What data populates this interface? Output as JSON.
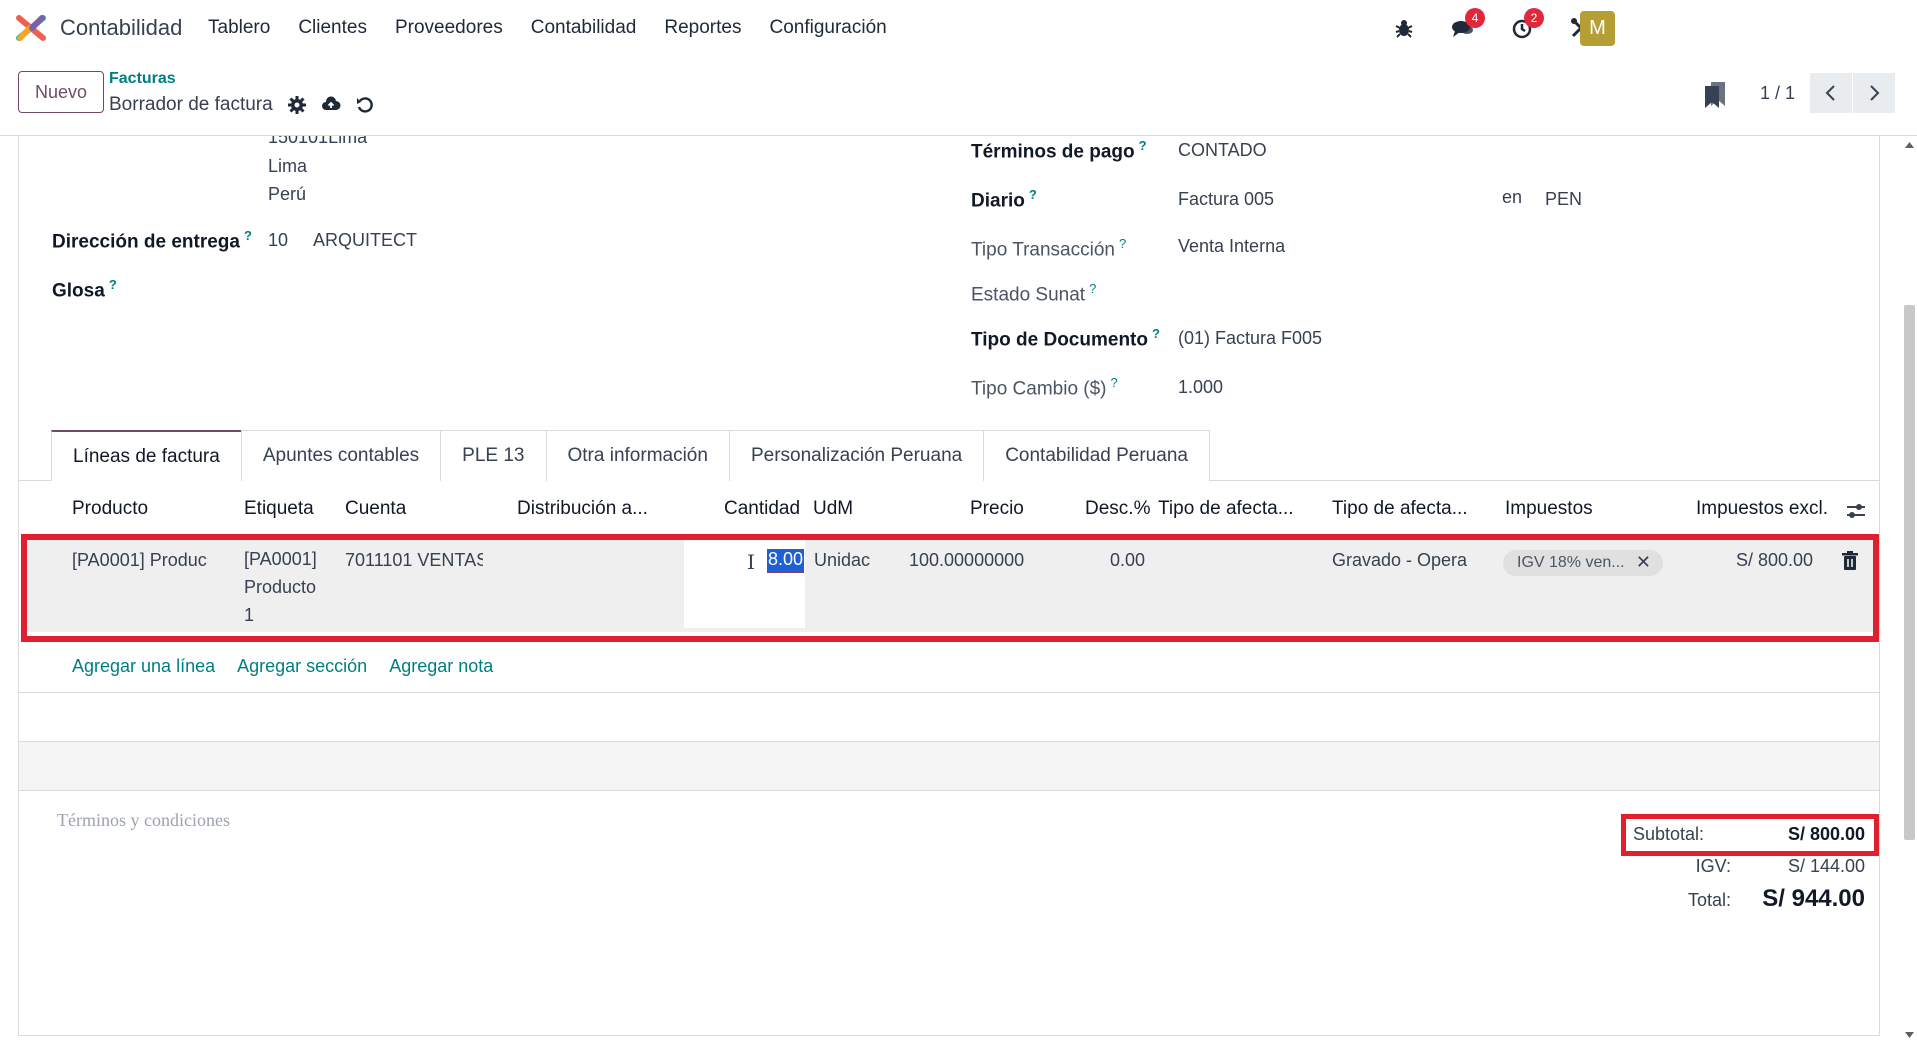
{
  "navbar": {
    "app_name": "Contabilidad",
    "menu": [
      "Tablero",
      "Clientes",
      "Proveedores",
      "Contabilidad",
      "Reportes",
      "Configuración"
    ],
    "messages_badge": "4",
    "activities_badge": "2",
    "avatar_letter": "M",
    "avatar_color": "#b59e33"
  },
  "control": {
    "new_label": "Nuevo",
    "breadcrumb": "Facturas",
    "title": "Borrador de factura",
    "pager": "1 / 1"
  },
  "form": {
    "address_line_1": "150101Lima",
    "address_line_2": "Lima",
    "address_line_3": "Perú",
    "delivery_label": "Dirección de entrega",
    "delivery_code": "10",
    "delivery_name": "ARQUITECT",
    "glosa_label": "Glosa",
    "payment_terms_label": "Términos de pago",
    "payment_terms_value": "CONTADO",
    "journal_label": "Diario",
    "journal_value": "Factura 005",
    "currency_prefix": "en",
    "currency_value": "PEN",
    "transaction_type_label": "Tipo Transacción",
    "transaction_type_value": "Venta Interna",
    "sunat_status_label": "Estado Sunat",
    "document_type_label": "Tipo de Documento",
    "document_type_value": "(01) Factura F005",
    "exchange_rate_label": "Tipo Cambio ($)",
    "exchange_rate_value": "1.000",
    "help_mark": "?"
  },
  "tabs": [
    "Líneas de factura",
    "Apuntes contables",
    "PLE 13",
    "Otra información",
    "Personalización Peruana",
    "Contabilidad Peruana"
  ],
  "table": {
    "headers": {
      "product": "Producto",
      "label": "Etiqueta",
      "account": "Cuenta",
      "distribution": "Distribución a...",
      "quantity": "Cantidad",
      "uom": "UdM",
      "price": "Precio",
      "discount": "Desc.%",
      "affect_type_1": "Tipo de afecta...",
      "affect_type_2": "Tipo de afecta...",
      "taxes": "Impuestos",
      "subtotal": "Impuestos excl."
    },
    "row": {
      "product": "[PA0001] Produc",
      "label_line1": "[PA0001]",
      "label_line2": "Producto",
      "label_line3": "1",
      "account": "7011101 VENTAS",
      "quantity": "8.00",
      "uom": "Unidac",
      "price": "100.00000000",
      "discount": "0.00",
      "affect_type_2": "Gravado - Opera",
      "tax_tag": "IGV 18% ven...",
      "subtotal": "S/ 800.00"
    },
    "add_line": "Agregar una línea",
    "add_section": "Agregar sección",
    "add_note": "Agregar nota"
  },
  "footer": {
    "terms_placeholder": "Términos y condiciones",
    "subtotal_label": "Subtotal:",
    "subtotal_value": "S/ 800.00",
    "igv_label": "IGV:",
    "igv_value": "S/ 144.00",
    "total_label": "Total:",
    "total_value": "S/ 944.00"
  },
  "colors": {
    "primary": "#714b67",
    "link": "#017e84",
    "highlight": "#e0202e",
    "selection": "#1f5fd6"
  }
}
